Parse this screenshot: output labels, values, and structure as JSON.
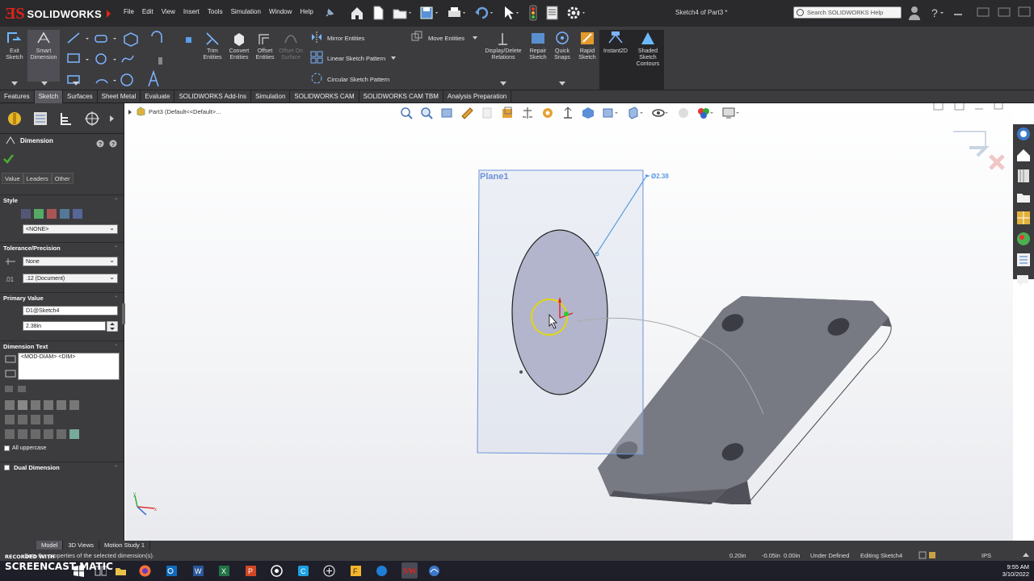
{
  "app": {
    "brand": "SOLIDWORKS",
    "title": "Sketch4 of Part3 *",
    "menus": [
      "File",
      "Edit",
      "View",
      "Insert",
      "Tools",
      "Simulation",
      "Window",
      "Help"
    ],
    "search_placeholder": "Search SOLIDWORKS Help"
  },
  "command_manager": {
    "exit_sketch": "Exit Sketch",
    "smart_dimension": "Smart Dimension",
    "trim_entities": "Trim Entities",
    "convert_entities": "Convert Entities",
    "offset_entities": "Offset Entities",
    "offset_on_surface": "Offset On Surface",
    "mirror_entities": "Mirror Entities",
    "linear_sketch_pattern": "Linear Sketch Pattern",
    "circular_sketch_pattern": "Circular Sketch Pattern",
    "move_entities": "Move Entities",
    "display_delete_relations": "Display/Delete Relations",
    "repair_sketch": "Repair Sketch",
    "quick_snaps": "Quick Snaps",
    "rapid_sketch": "Rapid Sketch",
    "instant2d": "Instant2D",
    "shaded_sketch_contours": "Shaded Sketch Contours"
  },
  "tabs": [
    "Features",
    "Sketch",
    "Sheet Metal",
    "Surfaces",
    "Evaluate",
    "SOLIDWORKS Add-Ins",
    "Simulation",
    "SOLIDWORKS CAM",
    "SOLIDWORKS CAM TBM",
    "Analysis Preparation"
  ],
  "active_tab": "Sketch",
  "property_manager": {
    "title": "Dimension",
    "subtabs": [
      "Value",
      "Leaders",
      "Other"
    ],
    "style_label": "Style",
    "style_value": "<NONE>",
    "tolerance_label": "Tolerance/Precision",
    "tolerance_value": "None",
    "precision_value": ".12 (Document)",
    "primary_value_label": "Primary Value",
    "primary_name": "D1@Sketch4",
    "primary_value": "2.38in",
    "dimension_text_label": "Dimension Text",
    "dimension_text": "<MOD-DIAM> <DIM>",
    "all_uppercase": "All uppercase",
    "dual_dimension": "Dual Dimension"
  },
  "graphics": {
    "tree_item": "Part3 (Default<<Default>...",
    "plane_label": "Plane1",
    "dim_label": "Ø2.38"
  },
  "model_tabs": [
    "Model",
    "3D Views",
    "Motion Study 1"
  ],
  "status": {
    "message": "Sets the properties of the selected dimension(s).",
    "x": "0.20in",
    "y": "-0.05in",
    "z": "0.00in",
    "definition": "Under Defined",
    "mode": "Editing Sketch4",
    "units": "IPS"
  },
  "watermark": {
    "line1": "RECORDED WITH",
    "line2": "SCREENCAST MATIC"
  },
  "clock": {
    "time": "9:55 AM",
    "date": "3/10/2022"
  }
}
